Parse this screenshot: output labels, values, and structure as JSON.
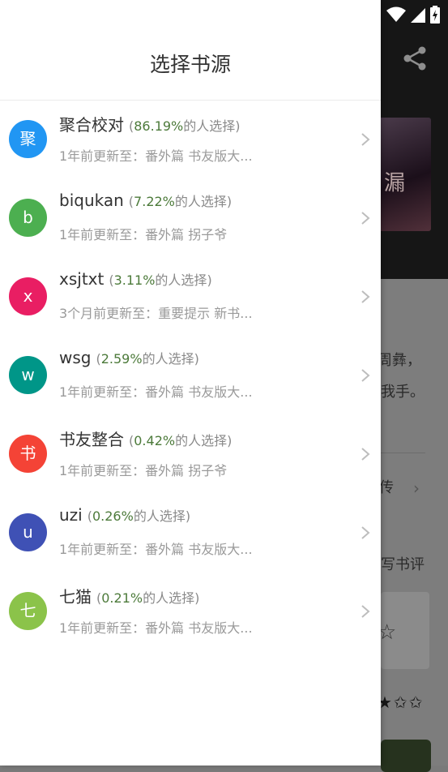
{
  "background": {
    "fragments": [
      "周彝，",
      "我手。",
      "传",
      "写书评"
    ],
    "cover_glyph": "漏"
  },
  "drawer": {
    "title": "选择书源"
  },
  "sources": [
    {
      "avatar": "聚",
      "color": "#2196F3",
      "name": "聚合校对",
      "percent": "86.19%",
      "suffix": "的人选择",
      "update": "1年前更新至：番外篇 书友版大..."
    },
    {
      "avatar": "b",
      "color": "#4CAF50",
      "name": "biqukan",
      "percent": "7.22%",
      "suffix": "的人选择",
      "update": "1年前更新至：番外篇 拐子爷"
    },
    {
      "avatar": "x",
      "color": "#E91E63",
      "name": "xsjtxt",
      "percent": "3.11%",
      "suffix": "的人选择",
      "update": "3个月前更新至：重要提示 新书..."
    },
    {
      "avatar": "w",
      "color": "#009688",
      "name": "wsg",
      "percent": "2.59%",
      "suffix": "的人选择",
      "update": "1年前更新至：番外篇 书友版大..."
    },
    {
      "avatar": "书",
      "color": "#F44336",
      "name": "书友整合",
      "percent": "0.42%",
      "suffix": "的人选择",
      "update": "1年前更新至：番外篇 拐子爷"
    },
    {
      "avatar": "u",
      "color": "#3F51B5",
      "name": "uzi",
      "percent": "0.26%",
      "suffix": "的人选择",
      "update": "1年前更新至：番外篇 书友版大..."
    },
    {
      "avatar": "七",
      "color": "#8BC34A",
      "name": "七猫",
      "percent": "0.21%",
      "suffix": "的人选择",
      "update": "1年前更新至：番外篇 书友版大..."
    }
  ],
  "icons": {
    "share": "share-icon",
    "chevron": "chevron-right-icon",
    "wifi": "wifi-icon",
    "signal": "signal-icon",
    "battery": "battery-icon"
  }
}
